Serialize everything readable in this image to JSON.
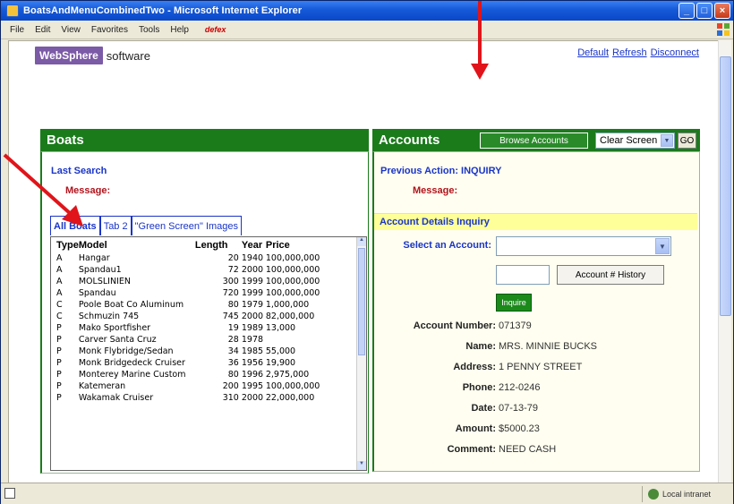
{
  "window": {
    "title": "BoatsAndMenuCombinedTwo - Microsoft Internet Explorer"
  },
  "menubar": {
    "items": [
      "File",
      "Edit",
      "View",
      "Favorites",
      "Tools",
      "Help"
    ],
    "logo_text": "defex"
  },
  "header": {
    "logo_box": "WebSphere",
    "logo_suffix": "software",
    "links": [
      "Default",
      "Refresh",
      "Disconnect"
    ]
  },
  "boats": {
    "title": "Boats",
    "last_search_label": "Last Search",
    "message_label": "Message:",
    "tabs": [
      "All Boats",
      "Tab 2",
      "\"Green Screen\" Images"
    ],
    "columns": [
      "Type",
      "Model",
      "Length",
      "Year",
      "Price"
    ],
    "rows": [
      {
        "type": "A",
        "model": "Hangar",
        "length": "20",
        "year": "1940",
        "price": "100,000,000"
      },
      {
        "type": "A",
        "model": "Spandau1",
        "length": "72",
        "year": "2000",
        "price": "100,000,000"
      },
      {
        "type": "A",
        "model": "MOLSLINIEN",
        "length": "300",
        "year": "1999",
        "price": "100,000,000"
      },
      {
        "type": "A",
        "model": "Spandau",
        "length": "720",
        "year": "1999",
        "price": "100,000,000"
      },
      {
        "type": "C",
        "model": "Poole Boat Co Aluminum",
        "length": "80",
        "year": "1979",
        "price": "1,000,000"
      },
      {
        "type": "C",
        "model": "Schmuzin 745",
        "length": "745",
        "year": "2000",
        "price": "82,000,000"
      },
      {
        "type": "P",
        "model": "Mako Sportfisher",
        "length": "19",
        "year": "1989",
        "price": "13,000"
      },
      {
        "type": "P",
        "model": "Carver Santa Cruz",
        "length": "28",
        "year": "1978",
        "price": ""
      },
      {
        "type": "P",
        "model": "Monk Flybridge/Sedan",
        "length": "34",
        "year": "1985",
        "price": "55,000"
      },
      {
        "type": "P",
        "model": "Monk Bridgedeck Cruiser",
        "length": "36",
        "year": "1956",
        "price": "19,900"
      },
      {
        "type": "P",
        "model": "Monterey Marine Custom",
        "length": "80",
        "year": "1996",
        "price": "2,975,000"
      },
      {
        "type": "P",
        "model": "Katemeran",
        "length": "200",
        "year": "1995",
        "price": "100,000,000"
      },
      {
        "type": "P",
        "model": "Wakamak Cruiser",
        "length": "310",
        "year": "2000",
        "price": "22,000,000"
      }
    ]
  },
  "accounts": {
    "title": "Accounts",
    "browse_button": "Browse Accounts",
    "clear_select_value": "Clear Screen",
    "go_button": "GO",
    "previous_action_label": "Previous Action: INQUIRY",
    "message_label": "Message:",
    "inquiry_title": "Account Details Inquiry",
    "select_label": "Select an Account:",
    "history_button": "Account # History",
    "inquire_button": "Inquire",
    "details": [
      {
        "label": "Account Number:",
        "value": "071379"
      },
      {
        "label": "Name:",
        "value": "MRS. MINNIE BUCKS"
      },
      {
        "label": "Address:",
        "value": "1 PENNY STREET"
      },
      {
        "label": "Phone:",
        "value": "212-0246"
      },
      {
        "label": "Date:",
        "value": "07-13-79"
      },
      {
        "label": "Amount:",
        "value": "$5000.23"
      },
      {
        "label": "Comment:",
        "value": "NEED CASH"
      }
    ]
  },
  "statusbar": {
    "zone": "Local intranet"
  },
  "colors": {
    "panel_green": "#1b7b1b",
    "link_blue": "#1a35c7",
    "message_red": "#b0141d",
    "inquiry_yellow": "#ffff99",
    "websphere_purple": "#7b5aa6",
    "annotation_red": "#e0141a"
  }
}
